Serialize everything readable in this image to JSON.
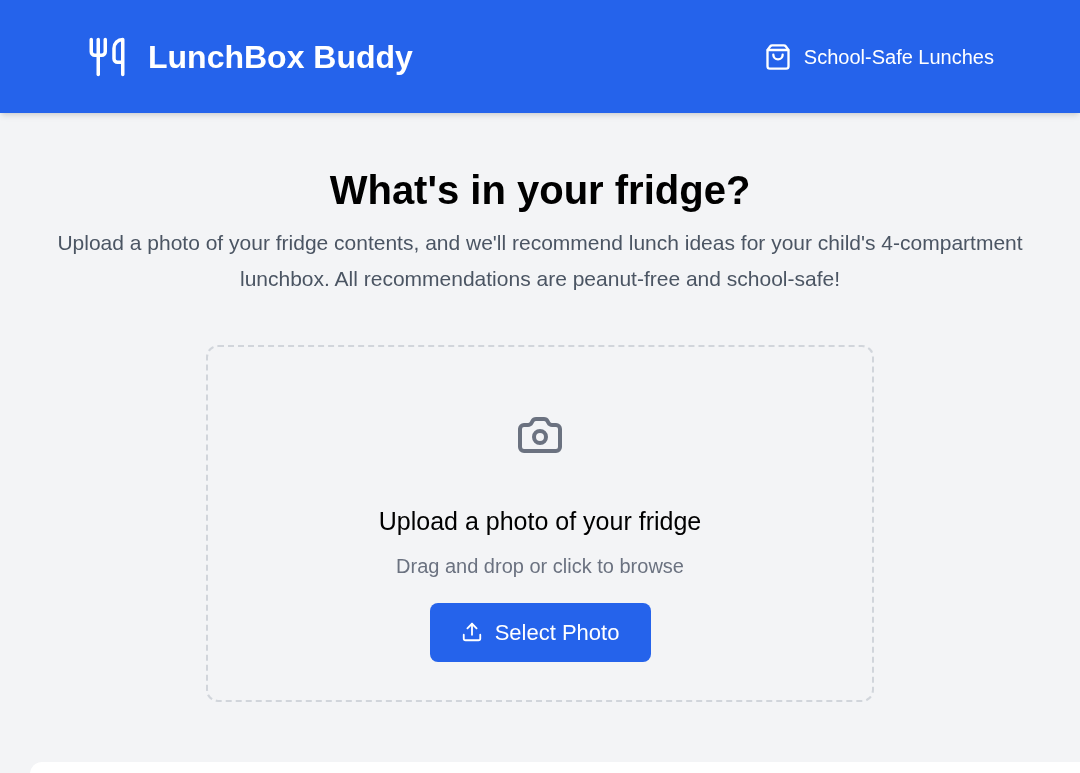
{
  "header": {
    "title": "LunchBox Buddy",
    "nav_link": "School-Safe Lunches"
  },
  "hero": {
    "title": "What's in your fridge?",
    "description": "Upload a photo of your fridge contents, and we'll recommend lunch ideas for your child's 4-compartment lunchbox. All recommendations are peanut-free and school-safe!"
  },
  "upload": {
    "title": "Upload a photo of your fridge",
    "hint": "Drag and drop or click to browse",
    "button": "Select Photo"
  }
}
